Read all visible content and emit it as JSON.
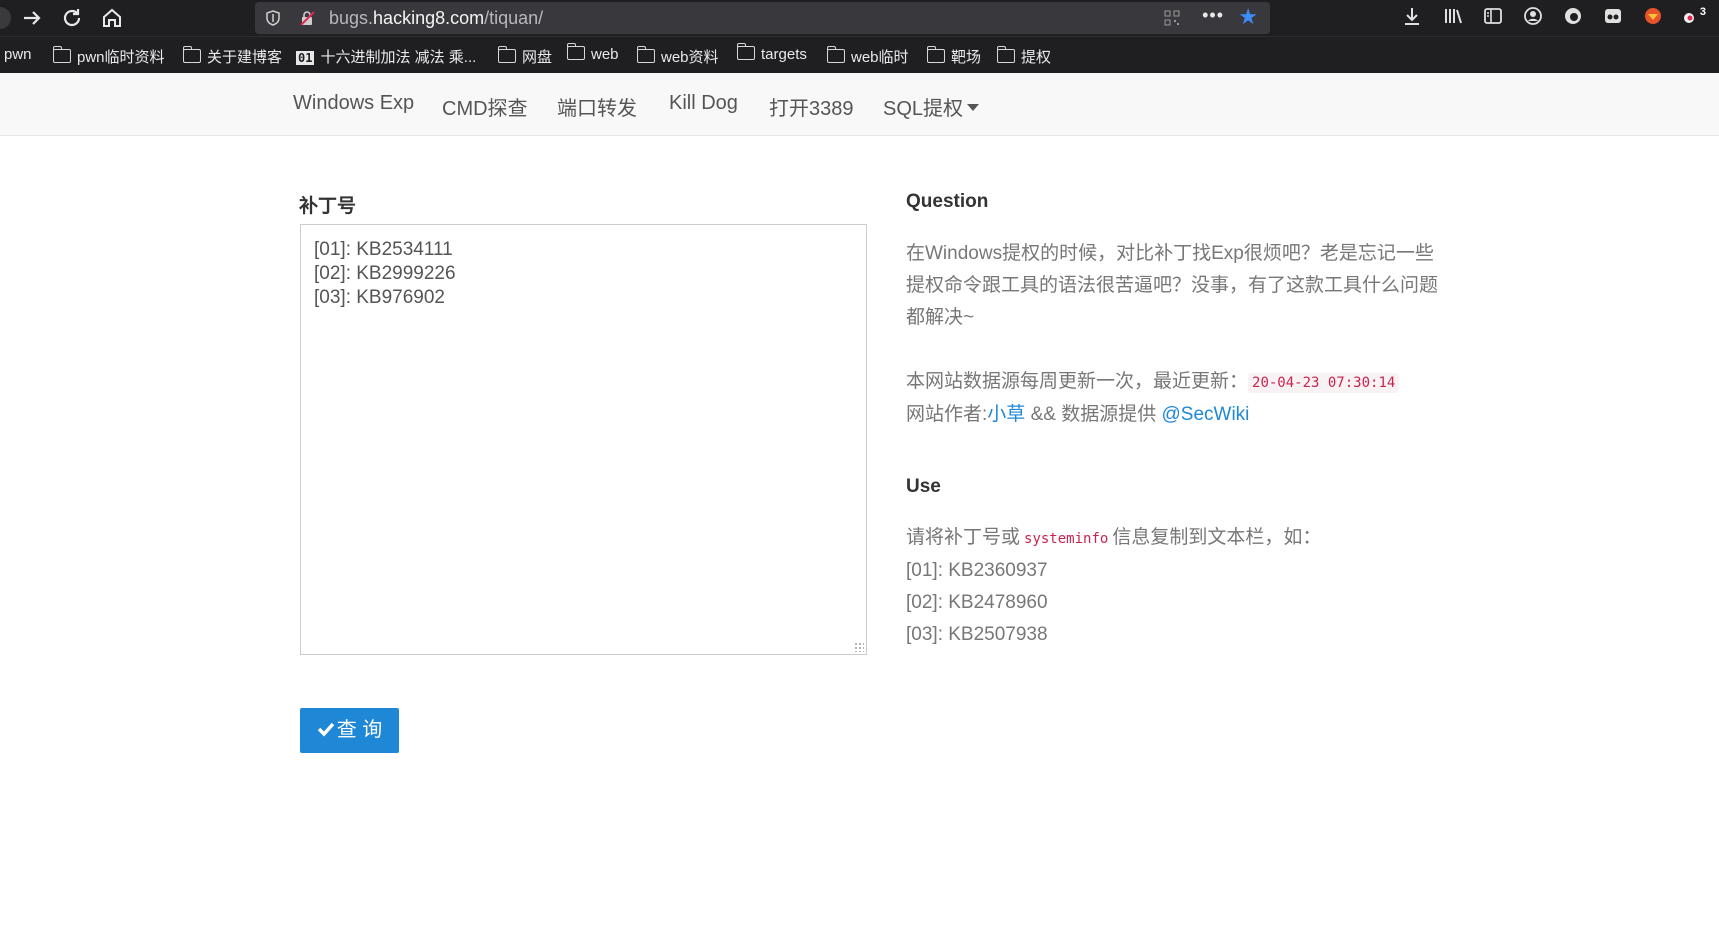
{
  "browser": {
    "url_host_prefix": "bugs.",
    "url_host": "hacking8.com",
    "url_path": "/tiquan/",
    "more_label": "•••",
    "badge_count": "3"
  },
  "bookmarks": [
    {
      "label": "pwn"
    },
    {
      "label": "pwn临时资料"
    },
    {
      "label": "关于建博客"
    },
    {
      "label": "十六进制加法 减法 乘...",
      "badge": "01"
    },
    {
      "label": "网盘"
    },
    {
      "label": "web"
    },
    {
      "label": "web资料"
    },
    {
      "label": "targets"
    },
    {
      "label": "web临时"
    },
    {
      "label": "靶场"
    },
    {
      "label": "提权"
    }
  ],
  "nav": {
    "items": [
      "Windows Exp",
      "CMD探查",
      "端口转发",
      "Kill Dog",
      "打开3389",
      "SQL提权"
    ]
  },
  "form": {
    "label": "补丁号",
    "patches": [
      "[01]: KB2534111",
      "[02]: KB2999226",
      "[03]: KB976902"
    ],
    "button_label": "查 询",
    "button_icon": "check-icon"
  },
  "question": {
    "title": "Question",
    "lines": [
      "在Windows提权的时候，对比补丁找Exp很烦吧？老是忘记一些",
      "提权命令跟工具的语法很苦逼吧？没事，有了这款工具什么问题",
      "都解决~"
    ],
    "update_prefix": "本网站数据源每周更新一次，最近更新：",
    "update_time": "20-04-23 07:30:14",
    "author_prefix": "网站作者:",
    "author": "小草",
    "source_mid": " && 数据源提供 ",
    "source": "@SecWiki"
  },
  "use": {
    "title": "Use",
    "intro_prefix": "请将补丁号或",
    "intro_code": "systeminfo",
    "intro_suffix": "信息复制到文本栏，如：",
    "examples": [
      "[01]: KB2360937",
      "[02]: KB2478960",
      "[03]: KB2507938"
    ]
  }
}
